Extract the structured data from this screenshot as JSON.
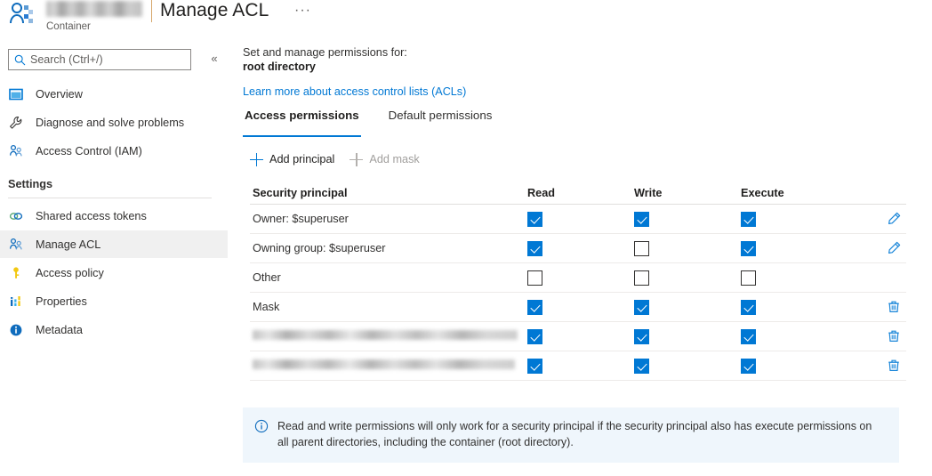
{
  "header": {
    "resource_name_redacted": true,
    "title": "Manage ACL",
    "subtitle": "Container",
    "more_menu": "···",
    "icon": "container-user-icon"
  },
  "sidebar": {
    "search": {
      "placeholder": "Search (Ctrl+/)",
      "value": "",
      "icon": "search-icon"
    },
    "collapse": {
      "glyph": "«"
    },
    "items": [
      {
        "label": "Overview",
        "icon": "overview-icon",
        "selected": false
      },
      {
        "label": "Diagnose and solve problems",
        "icon": "wrench-icon",
        "selected": false
      },
      {
        "label": "Access Control (IAM)",
        "icon": "people-icon",
        "selected": false
      }
    ],
    "section": {
      "title": "Settings"
    },
    "settings_items": [
      {
        "label": "Shared access tokens",
        "icon": "link-icon",
        "selected": false
      },
      {
        "label": "Manage ACL",
        "icon": "people-icon",
        "selected": true
      },
      {
        "label": "Access policy",
        "icon": "key-icon",
        "selected": false
      },
      {
        "label": "Properties",
        "icon": "properties-icon",
        "selected": false
      },
      {
        "label": "Metadata",
        "icon": "info-icon",
        "selected": false
      }
    ]
  },
  "main": {
    "lead_line1": "Set and manage permissions for:",
    "lead_line2": "root directory",
    "learn_more_link": "Learn more about access control lists (ACLs)",
    "tabs": [
      {
        "label": "Access permissions",
        "active": true
      },
      {
        "label": "Default permissions",
        "active": false
      }
    ],
    "commands": [
      {
        "label": "Add principal",
        "icon": "plus-icon",
        "disabled": false
      },
      {
        "label": "Add mask",
        "icon": "plus-icon",
        "disabled": true
      }
    ],
    "table": {
      "columns": [
        "Security principal",
        "Read",
        "Write",
        "Execute",
        ""
      ],
      "rows": [
        {
          "name": "Owner: $superuser",
          "redacted": false,
          "read": true,
          "write": true,
          "execute": true,
          "action": "edit-icon"
        },
        {
          "name": "Owning group: $superuser",
          "redacted": false,
          "read": true,
          "write": false,
          "execute": true,
          "action": "edit-icon"
        },
        {
          "name": "Other",
          "redacted": false,
          "read": false,
          "write": false,
          "execute": false,
          "action": "none"
        },
        {
          "name": "Mask",
          "redacted": false,
          "read": true,
          "write": true,
          "execute": true,
          "action": "delete-icon"
        },
        {
          "name": "",
          "redacted": true,
          "redact_width": 298,
          "read": true,
          "write": true,
          "execute": true,
          "action": "delete-icon"
        },
        {
          "name": "",
          "redacted": true,
          "redact_width": 295,
          "read": true,
          "write": true,
          "execute": true,
          "action": "delete-icon"
        }
      ]
    },
    "banner": {
      "icon": "info-icon",
      "text": "Read and write permissions will only work for a security principal if the security principal also has execute permissions on all parent directories, including the container (root directory)."
    }
  },
  "colors": {
    "accent": "#0078d4",
    "banner_bg": "#eff6fc",
    "selected_row": "#f0f0f0",
    "border": "#edebe9"
  }
}
